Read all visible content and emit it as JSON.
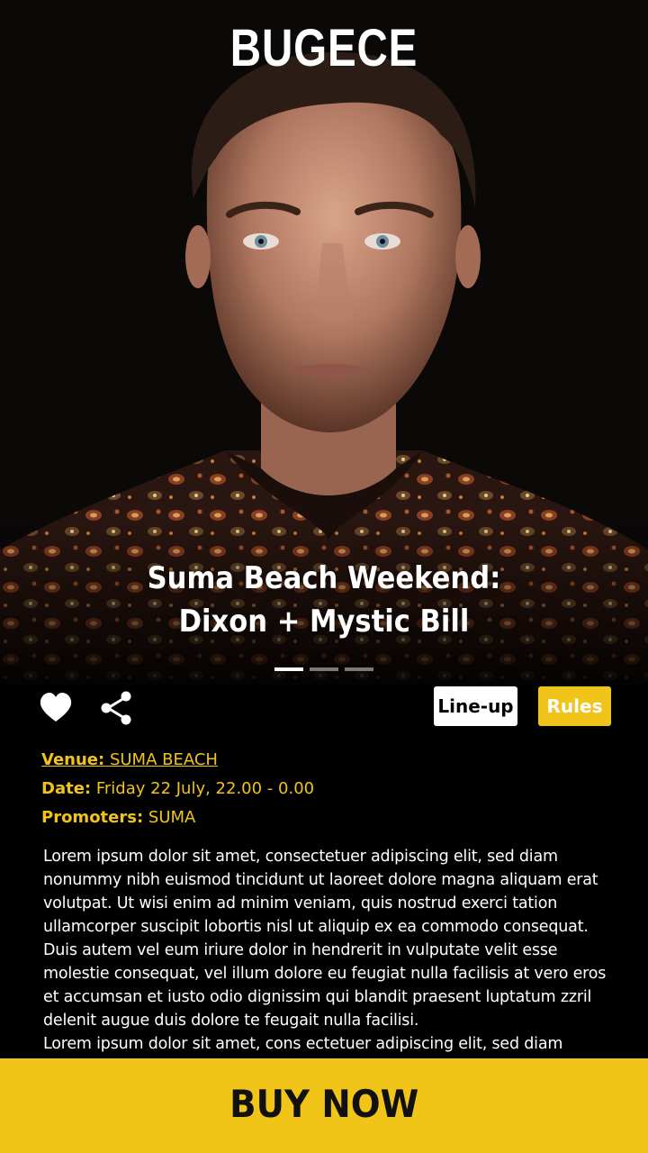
{
  "header": {
    "logo": "BUGECE"
  },
  "hero": {
    "title_line1": "Suma Beach Weekend:",
    "title_line2": "Dixon + Mystic Bill",
    "pager": {
      "count": 3,
      "active": 0
    }
  },
  "actions": {
    "favorite_icon": "heart-icon",
    "share_icon": "share-icon",
    "lineup_label": "Line-up",
    "rules_label": "Rules"
  },
  "details": {
    "venue_label": "Venue:",
    "venue_value": "SUMA BEACH ",
    "date_label": "Date:",
    "date_value": "Friday 22 July, 22.00 - 0.00",
    "promoters_label": "Promoters:",
    "promoters_value": "SUMA"
  },
  "description": "Lorem ipsum dolor sit amet, consectetuer adipiscing elit, sed diam\nnonummy nibh euismod tincidunt ut laoreet dolore magna aliquam erat\nvolutpat. Ut wisi enim ad minim veniam, quis nostrud exerci tation\nullamcorper suscipit lobortis nisl ut aliquip ex ea commodo consequat.\nDuis autem vel eum iriure dolor in hendrerit in vulputate velit esse\nmolestie consequat, vel illum dolore eu feugiat nulla facilisis at vero eros\net accumsan et iusto odio dignissim qui blandit praesent luptatum zzril\ndelenit augue duis dolore te feugait nulla facilisi.\nLorem ipsum dolor sit amet, cons ectetuer adipiscing elit, sed diam",
  "cta": {
    "buy_label": "BUY NOW"
  },
  "colors": {
    "accent": "#f0c419",
    "background": "#000000",
    "text": "#ffffff"
  }
}
